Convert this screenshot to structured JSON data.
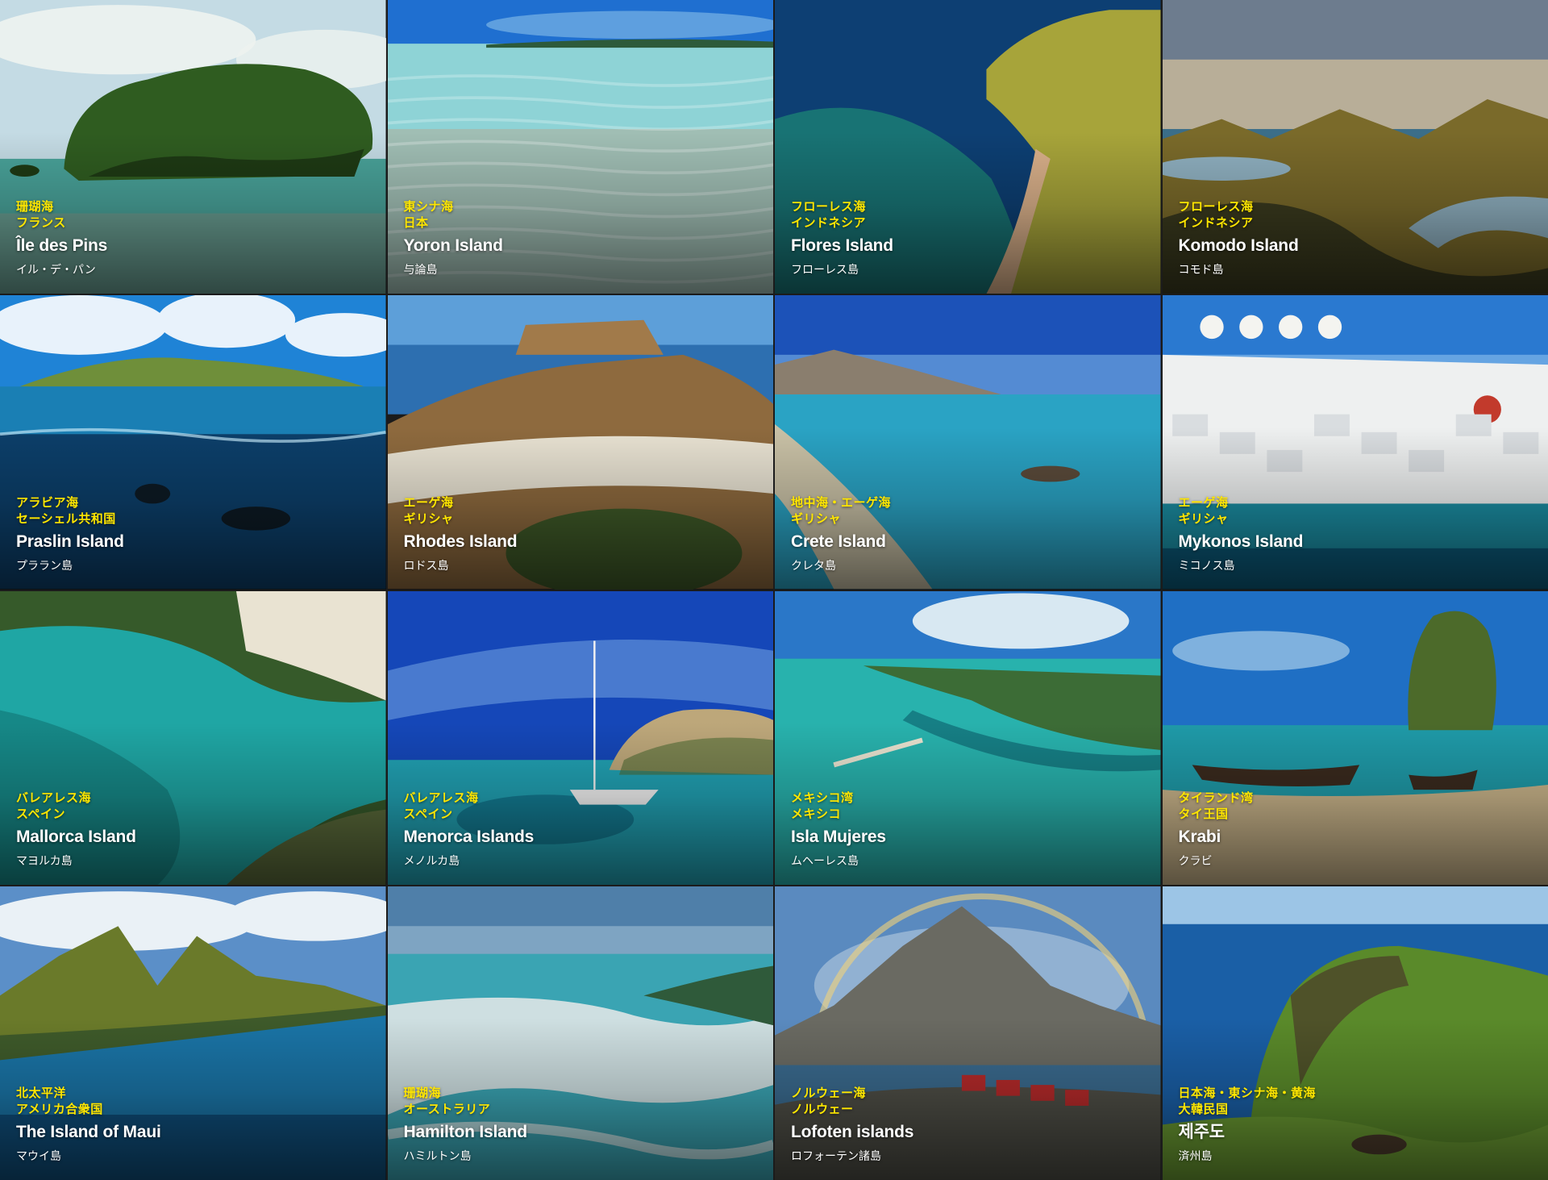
{
  "tiles": [
    {
      "sea": "珊瑚海",
      "country": "フランス",
      "name": "Île des Pins",
      "jname": "イル・デ・パン",
      "scene": "Small forested limestone islet with mushroom-shaped rock on a shallow turquoise lagoon under a cloudy blue sky",
      "colors": {
        "sky": "#c4dbe4",
        "sky2": "#eef3ef",
        "water": "#49a39a",
        "water2": "#7e9b8d",
        "land": "#2f5c20",
        "land2": "#1e3a14"
      }
    },
    {
      "sea": "東シナ海",
      "country": "日本",
      "name": "Yoron Island",
      "jname": "与論島",
      "scene": "Crystal-clear shallow sea with rippled sand bottom, distant flat island on the horizon and blue sky",
      "colors": {
        "sky": "#1f6fd0",
        "sky2": "#79b3e6",
        "water": "#8ed3d6",
        "water2": "#b6a58c",
        "land": "#2d5a3a",
        "land2": "#ffffff"
      }
    },
    {
      "sea": "フローレス海",
      "country": "インドネシア",
      "name": "Flores Island",
      "jname": "フローレス島",
      "scene": "Aerial view of a green headland with a curving sandy spit into deep blue and turquoise sea, small boats",
      "colors": {
        "sky": "#0b2e6d",
        "sky2": "#0f5a7a",
        "water": "#1b7d74",
        "water2": "#0d3f73",
        "land": "#a7a43a",
        "land2": "#d9b08a"
      }
    },
    {
      "sea": "フローレス海",
      "country": "インドネシア",
      "name": "Komodo Island",
      "jname": "コモド島",
      "scene": "Golden-hour view of green ridged hills curving around blue bays with a cloudy sky",
      "colors": {
        "sky": "#6d7c8e",
        "sky2": "#d9c39c",
        "water": "#3b6e89",
        "water2": "#8fb0c0",
        "land": "#7a6a2a",
        "land2": "#3a3a1e"
      }
    },
    {
      "sea": "アラビア海",
      "country": "セーシェル共和国",
      "name": "Praslin Island",
      "jname": "プララン島",
      "scene": "Split over-under view: granite boulder island on the horizon above, divers swimming in blue water below",
      "colors": {
        "sky": "#1f83d6",
        "sky2": "#e8f2fb",
        "water": "#1a7fb4",
        "water2": "#0c3f6a",
        "land": "#6f8f3a",
        "land2": "#0d1a24"
      }
    },
    {
      "sea": "エーゲ海",
      "country": "ギリシャ",
      "name": "Rhodes Island",
      "jname": "ロドス島",
      "scene": "Ancient acropolis fortress on a hilltop above a white village, blue sea behind and green trees in front",
      "colors": {
        "sky": "#5d9fd9",
        "sky2": "#a9cce8",
        "water": "#2d6fb0",
        "water2": "#e8e2d2",
        "land": "#8e6a3e",
        "land2": "#3f5a28"
      }
    },
    {
      "sea": "地中海・エーゲ海",
      "country": "ギリシャ",
      "name": "Crete Island",
      "jname": "クレタ島",
      "scene": "Shallow turquoise lagoon with a sand bar, brown mountains on the far shore and a deep blue sky",
      "colors": {
        "sky": "#1c52b8",
        "sky2": "#7ab3e4",
        "water": "#2aa3c4",
        "water2": "#c9c1a6",
        "land": "#8a7e6e",
        "land2": "#5a4a3a"
      }
    },
    {
      "sea": "エーゲ海",
      "country": "ギリシャ",
      "name": "Mykonos Island",
      "jname": "ミコノス島",
      "scene": "Whitewashed town with windmills on the hill, a red-domed church, a harbor with boats in blue water",
      "colors": {
        "sky": "#2a79d0",
        "sky2": "#8ec2ee",
        "water": "#1b8ea3",
        "water2": "#0b5a7a",
        "land": "#eef0f0",
        "land2": "#c23a2c"
      }
    },
    {
      "sea": "バレアレス海",
      "country": "スペイン",
      "name": "Mallorca Island",
      "jname": "マヨルカ島",
      "scene": "Aerial view of a turquoise cove with a sandy beach and pine-covered rocky shoreline",
      "colors": {
        "sky": "#2d5a2a",
        "sky2": "#e9e3d2",
        "water": "#1fa6a4",
        "water2": "#0e6a6a",
        "land": "#365a2a",
        "land2": "#d8cbb0"
      }
    },
    {
      "sea": "バレアレス海",
      "country": "スペイン",
      "name": "Menorca Islands",
      "jname": "メノルカ島",
      "scene": "Sailboat anchored in turquoise water beside a rocky cliff under a bright blue sky with wispy clouds",
      "colors": {
        "sky": "#1547b8",
        "sky2": "#8ab8ea",
        "water": "#21a1b3",
        "water2": "#0e6b85",
        "land": "#bda77a",
        "land2": "#4f6a34"
      }
    },
    {
      "sea": "メキシコ湾",
      "country": "メキシコ",
      "name": "Isla Mujeres",
      "jname": "ムヘーレス島",
      "scene": "Aerial view of a narrow island with hotels and a long pier over turquoise Caribbean water, clouds above",
      "colors": {
        "sky": "#2a77c8",
        "sky2": "#d8e8f2",
        "water": "#28b2ad",
        "water2": "#12727a",
        "land": "#3c6c36",
        "land2": "#e8e2cf"
      }
    },
    {
      "sea": "タイランド湾",
      "country": "タイ王国",
      "name": "Krabi",
      "jname": "クラビ",
      "scene": "Tall limestone karst rising from the sea, long-tail boats on the shore, green vegetation and blue sky",
      "colors": {
        "sky": "#1f6fc4",
        "sky2": "#a8cdea",
        "water": "#1f9aa8",
        "water2": "#0e6276",
        "land": "#4c6a2a",
        "land2": "#3a2a1e"
      }
    },
    {
      "sea": "北太平洋",
      "country": "アメリカ合衆国",
      "name": "The Island of Maui",
      "jname": "マウイ島",
      "scene": "Aerial view of green volcanic mountains with clouds, coastline with reefs and deep blue ocean",
      "colors": {
        "sky": "#5b8fc8",
        "sky2": "#eaf1f6",
        "water": "#1a74a6",
        "water2": "#0b3e6a",
        "land": "#6a7a2a",
        "land2": "#3e5a2a"
      }
    },
    {
      "sea": "珊瑚海",
      "country": "オーストラリア",
      "name": "Hamilton Island",
      "jname": "ハミルトン島",
      "scene": "Swirling white silica sand and turquoise water at low tide, forested headland and distant islands",
      "colors": {
        "sky": "#4f7fa9",
        "sky2": "#9fbcd3",
        "water": "#3aa4b3",
        "water2": "#dfe6e6",
        "land": "#2f5a3a",
        "land2": "#e6ecec"
      }
    },
    {
      "sea": "ノルウェー海",
      "country": "ノルウェー",
      "name": "Lofoten islands",
      "jname": "ロフォーテン諸島",
      "scene": "Rainbow over a jagged granite peak, red fishermen's cabins on rocky shore beside calm water",
      "colors": {
        "sky": "#5a8abf",
        "sky2": "#c7d7e6",
        "water": "#3a6a8e",
        "water2": "#6e8a5a",
        "land": "#6a6a62",
        "land2": "#b52a2a"
      }
    },
    {
      "sea": "日本海・東シナ海・黄海",
      "country": "大韓民国",
      "name": "제주도",
      "jname": "済州島",
      "scene": "Grassy volcanic cliff and headland beside a deep blue sea, a brown horse grazing in the foreground",
      "colors": {
        "sky": "#9cc5e6",
        "sky2": "#d8e7f2",
        "water": "#1a5fa6",
        "water2": "#2a7fc0",
        "land": "#5a8a2a",
        "land2": "#4a3a2a"
      }
    }
  ]
}
